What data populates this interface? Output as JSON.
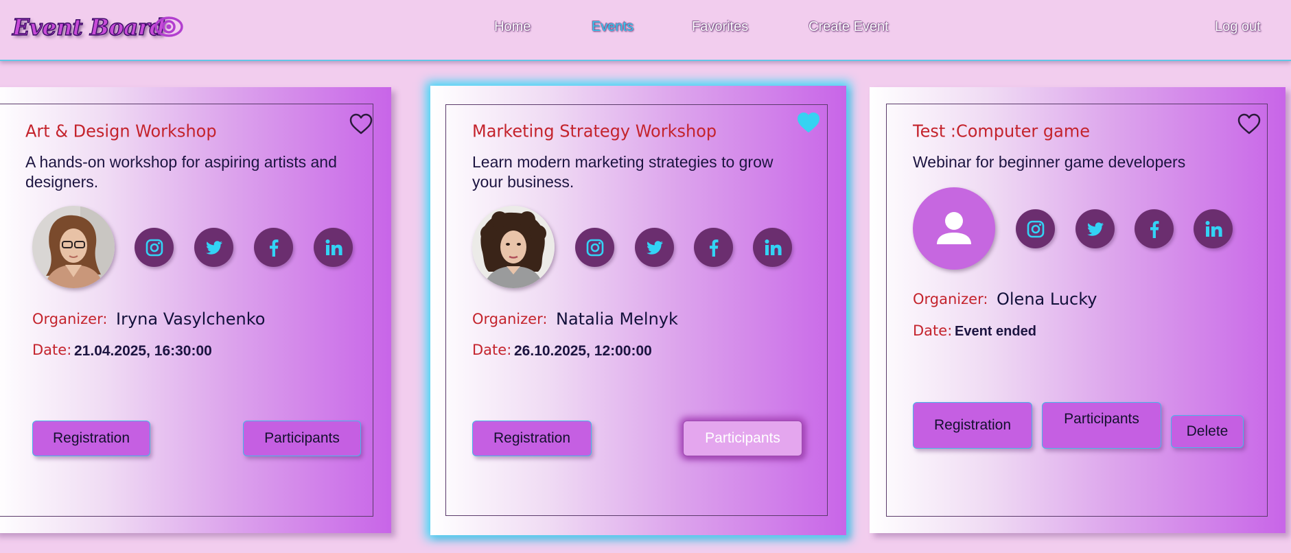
{
  "app": {
    "logo_text": "Event Board",
    "nav": [
      {
        "label": "Home",
        "active": false
      },
      {
        "label": "Events",
        "active": true
      },
      {
        "label": "Favorites",
        "active": false
      },
      {
        "label": "Create Event",
        "active": false
      }
    ],
    "logout_label": "Log out"
  },
  "colors": {
    "background": "#f2cdee",
    "accent_cyan": "#36c9f1",
    "button": "#c55fe2",
    "title_red": "#c4232c",
    "social_bg": "#6b2e6f"
  },
  "events": [
    {
      "title": "Art & Design Workshop",
      "description": "A hands-on workshop for aspiring artists and designers.",
      "favorite": false,
      "organizer_label": "Organizer:",
      "organizer": "Iryna Vasylchenko",
      "date_label": "Date:",
      "date": "21.04.2025, 16:30:00",
      "avatar": "woman-with-glasses-photo",
      "social_icons": [
        "instagram-icon",
        "twitter-icon",
        "facebook-icon",
        "linkedin-icon"
      ],
      "buttons": [
        "Registration",
        "Participants"
      ]
    },
    {
      "title": "Marketing Strategy Workshop",
      "description": "Learn modern marketing strategies to grow your business.",
      "favorite": true,
      "organizer_label": "Organizer:",
      "organizer": "Natalia Melnyk",
      "date_label": "Date:",
      "date": "26.10.2025, 12:00:00",
      "avatar": "curly-haired-woman-photo",
      "social_icons": [
        "instagram-icon",
        "twitter-icon",
        "facebook-icon",
        "linkedin-icon"
      ],
      "buttons": [
        "Registration",
        "Participants"
      ]
    },
    {
      "title": "Test :Computer game",
      "description": "Webinar for beginner game developers",
      "favorite": false,
      "organizer_label": "Organizer:",
      "organizer": "Olena Lucky",
      "date_label": "Date:",
      "date": "Event ended",
      "avatar": "default-user-icon",
      "social_icons": [
        "instagram-icon",
        "twitter-icon",
        "facebook-icon",
        "linkedin-icon"
      ],
      "buttons": [
        "Registration",
        "Participants",
        "Delete"
      ]
    }
  ]
}
